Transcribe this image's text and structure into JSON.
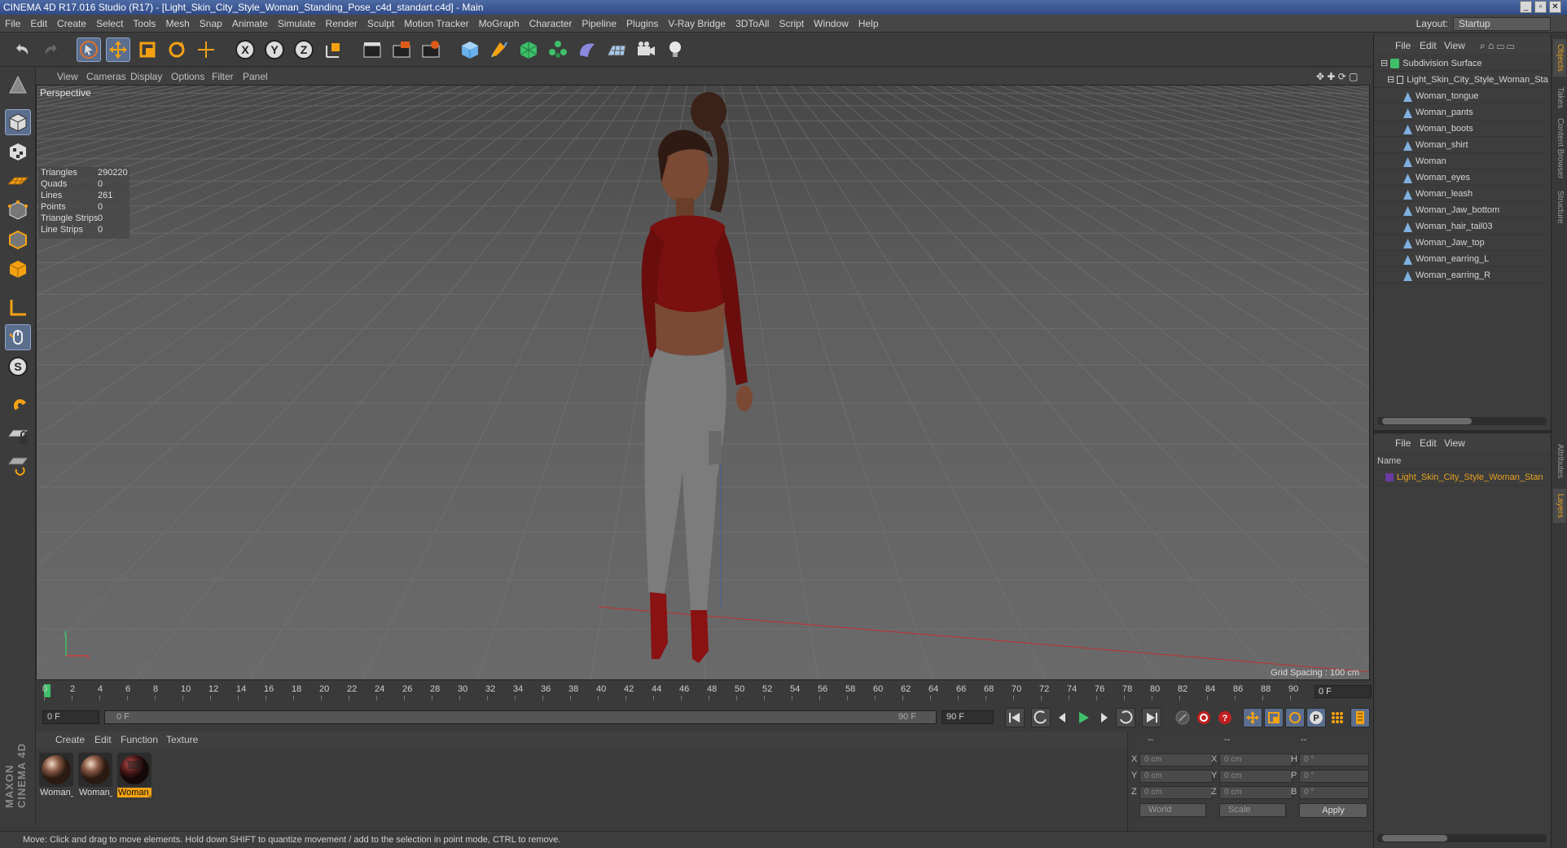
{
  "title": "CINEMA 4D R17.016 Studio (R17) - [Light_Skin_City_Style_Woman_Standing_Pose_c4d_standart.c4d] - Main",
  "window_controls": [
    "_",
    "▫",
    "✕"
  ],
  "menu": [
    "File",
    "Edit",
    "Create",
    "Select",
    "Tools",
    "Mesh",
    "Snap",
    "Animate",
    "Simulate",
    "Render",
    "Sculpt",
    "Motion Tracker",
    "MoGraph",
    "Character",
    "Pipeline",
    "Plugins",
    "V-Ray Bridge",
    "3DToAll",
    "Script",
    "Window",
    "Help"
  ],
  "layout": {
    "label": "Layout:",
    "value": "Startup"
  },
  "viewport": {
    "menu": [
      "View",
      "Cameras",
      "Display",
      "Options",
      "Filter",
      "Panel"
    ],
    "camera": "Perspective",
    "stats": [
      {
        "label": "Triangles",
        "value": "290220"
      },
      {
        "label": "Quads",
        "value": "0"
      },
      {
        "label": "Lines",
        "value": "261"
      },
      {
        "label": "Points",
        "value": "0"
      },
      {
        "label": "Triangle Strips",
        "value": "0"
      },
      {
        "label": "Line Strips",
        "value": "0"
      }
    ],
    "grid_spacing": "Grid Spacing : 100 cm"
  },
  "timeline": {
    "ticks": [
      "0",
      "2",
      "4",
      "6",
      "8",
      "10",
      "12",
      "14",
      "16",
      "18",
      "20",
      "22",
      "24",
      "26",
      "28",
      "30",
      "32",
      "34",
      "36",
      "38",
      "40",
      "42",
      "44",
      "46",
      "48",
      "50",
      "52",
      "54",
      "56",
      "58",
      "60",
      "62",
      "64",
      "66",
      "68",
      "70",
      "72",
      "74",
      "76",
      "78",
      "80",
      "82",
      "84",
      "86",
      "88",
      "90"
    ],
    "current_frame": "0 F",
    "start_field": "0 F",
    "range_start": "0 F",
    "range_end": "90 F",
    "end_field": "90 F"
  },
  "material": {
    "menu": [
      "Create",
      "Edit",
      "Function",
      "Texture"
    ],
    "items": [
      {
        "label": "Woman_",
        "selected": false
      },
      {
        "label": "Woman_",
        "selected": false
      },
      {
        "label": "Woman_",
        "selected": true
      }
    ]
  },
  "coords": {
    "header": [
      "--",
      "--",
      "--"
    ],
    "rows": [
      {
        "a": "X",
        "av": "0 cm",
        "b": "X",
        "bv": "0 cm",
        "c": "H",
        "cv": "0 °"
      },
      {
        "a": "Y",
        "av": "0 cm",
        "b": "Y",
        "bv": "0 cm",
        "c": "P",
        "cv": "0 °"
      },
      {
        "a": "Z",
        "av": "0 cm",
        "b": "Z",
        "bv": "0 cm",
        "c": "B",
        "cv": "0 °"
      }
    ],
    "mode": "World",
    "scale": "Scale",
    "apply": "Apply"
  },
  "status": "Move: Click and drag to move elements. Hold down SHIFT to quantize movement / add to the selection in point mode, CTRL to remove.",
  "objects": {
    "menu": [
      "File",
      "Edit",
      "View"
    ],
    "root": "Subdivision Surface",
    "group": "Light_Skin_City_Style_Woman_Sta",
    "children": [
      "Woman_tongue",
      "Woman_pants",
      "Woman_boots",
      "Woman_shirt",
      "Woman",
      "Woman_eyes",
      "Woman_leash",
      "Woman_Jaw_bottom",
      "Woman_hair_tail03",
      "Woman_Jaw_top",
      "Woman_earring_L",
      "Woman_earring_R"
    ]
  },
  "layers": {
    "menu": [
      "File",
      "Edit",
      "View"
    ],
    "header": "Name",
    "item": "Light_Skin_City_Style_Woman_Stan"
  },
  "side_tabs": [
    "Objects",
    "Takes",
    "Content Browser",
    "Structure",
    "Attributes",
    "Layers"
  ],
  "colors": {
    "accent": "#f4a212",
    "selection": "#5b6e8e",
    "object_icon": "#7fb0e0",
    "layer_text": "#e4a020"
  },
  "icons": {
    "toolbar": [
      "undo-icon",
      "redo-icon",
      "live-selection-icon",
      "move-icon",
      "scale-icon",
      "rotate-icon",
      "add-object-icon",
      "x-axis-icon",
      "y-axis-icon",
      "z-axis-icon",
      "coordinate-system-icon",
      "render-view-icon",
      "render-picture-viewer-icon",
      "render-settings-icon",
      "cube-icon",
      "pen-icon",
      "subdivision-icon",
      "mograph-cloner-icon",
      "deformer-icon",
      "floor-icon",
      "camera-icon",
      "light-icon"
    ],
    "left": [
      "make-editable-icon",
      "model-mode-icon",
      "texture-mode-icon",
      "workplane-icon",
      "points-mode-icon",
      "edges-mode-icon",
      "polygons-mode-icon",
      "axis-mode-icon",
      "tweak-mode-icon",
      "solo-icon",
      "snap-icon",
      "workplane-lock-icon",
      "workplane-mode-icon"
    ]
  }
}
